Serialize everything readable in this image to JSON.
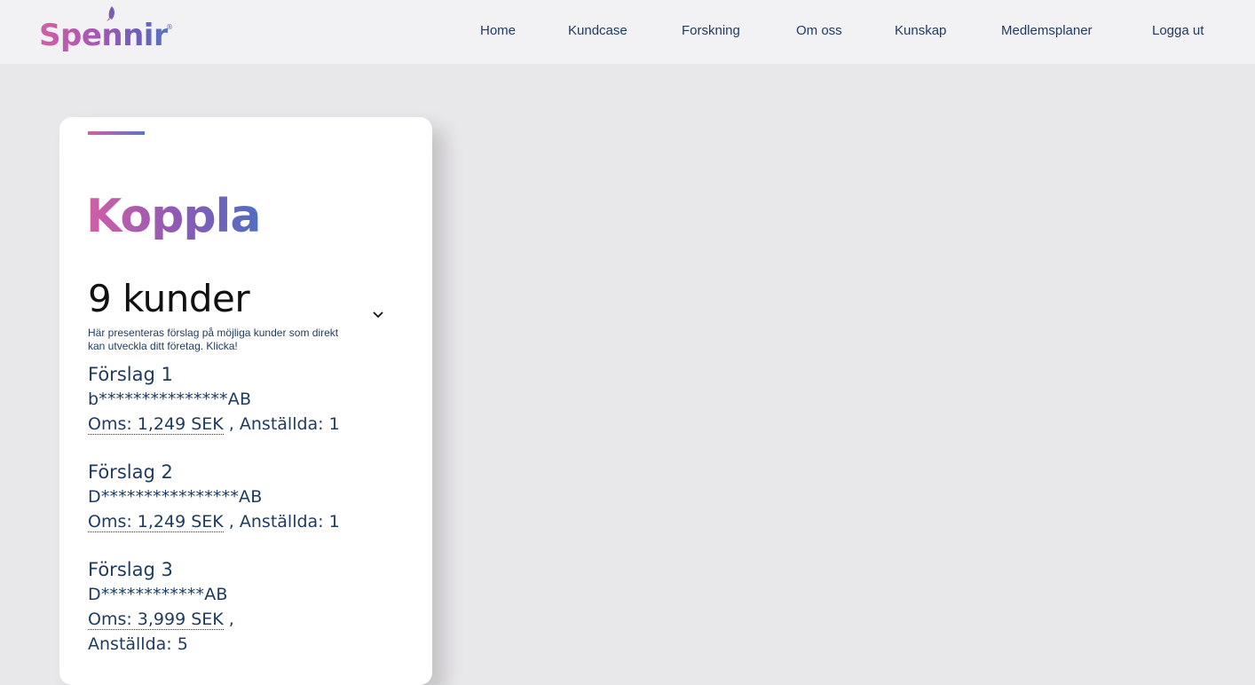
{
  "brand": {
    "name": "Spennir",
    "registered": "®"
  },
  "nav": [
    {
      "label": "Home"
    },
    {
      "label": "Kundcase"
    },
    {
      "label": "Forskning"
    },
    {
      "label": "Om oss"
    },
    {
      "label": "Kunskap"
    },
    {
      "label": "Medlemsplaner"
    },
    {
      "label": "Logga ut"
    }
  ],
  "card": {
    "title": "Koppla",
    "count": "9 kunder",
    "description": "Här presenteras förslag på möjliga kunder som direkt kan utveckla ditt företag. Klicka!",
    "suggestions": [
      {
        "title": "Förslag 1",
        "name": "b***************AB",
        "oms": "Oms: 1,249 SEK",
        "sep": " , ",
        "employees": "Anställda: 1"
      },
      {
        "title": "Förslag 2",
        "name": "D****************AB",
        "oms": "Oms: 1,249 SEK",
        "sep": " , ",
        "employees": "Anställda: 1"
      },
      {
        "title": "Förslag 3",
        "name": "D************AB",
        "oms": "Oms: 3,999 SEK",
        "sep": " , ",
        "employees": "Anställda: 5"
      }
    ]
  },
  "icons": {
    "dropdown": "chevron-down-icon",
    "logo": "rocket-icon"
  },
  "colors": {
    "background": "#e8e7ea",
    "header": "#f2f2f4",
    "text": "#1d3a5f",
    "gradient_start": "#d25fa6",
    "gradient_end": "#5a76c4"
  }
}
